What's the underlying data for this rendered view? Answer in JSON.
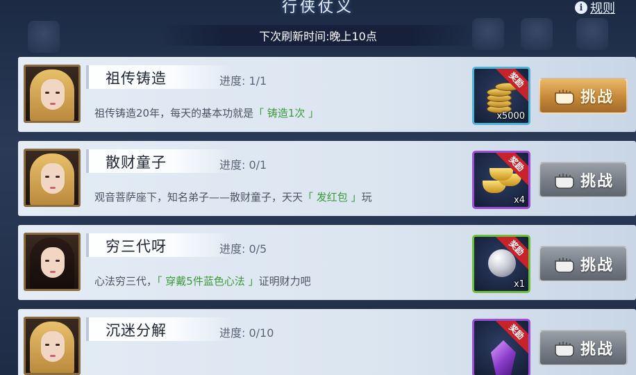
{
  "header": {
    "title": "行侠仗义",
    "rules_label": "规则",
    "refresh_text": "下次刷新时间:晚上10点"
  },
  "colors": {
    "highlight_green": "#3a9a3a",
    "ribbon_red": "#c8222a",
    "button_gold": "#c98c3c",
    "button_gray": "#7a8089"
  },
  "tasks": [
    {
      "name": "祖传铸造",
      "progress": "进度: 1/1",
      "desc_prefix": "祖传铸造20年，每天的基本功就是",
      "desc_highlight": "「 铸造1次 」",
      "desc_suffix": "",
      "reward_ribbon": "奖励",
      "reward_icon": "gold-coins-icon",
      "reward_qty": "x5000",
      "button_label": "挑战",
      "button_state": "active"
    },
    {
      "name": "散财童子",
      "progress": "进度: 0/1",
      "desc_prefix": "观音菩萨座下，知名弟子——散财童子，天天",
      "desc_highlight": "「 发红包 」",
      "desc_suffix": "玩",
      "reward_ribbon": "奖励",
      "reward_icon": "gold-ingot-icon",
      "reward_qty": "x4",
      "button_label": "挑战",
      "button_state": "inactive"
    },
    {
      "name": "穷三代呀",
      "progress": "进度: 0/5",
      "desc_prefix": "心法穷三代，",
      "desc_highlight": "「 穿戴5件蓝色心法 」",
      "desc_suffix": "证明财力吧",
      "reward_ribbon": "奖励",
      "reward_icon": "pearl-icon",
      "reward_qty": "x1",
      "button_label": "挑战",
      "button_state": "inactive"
    },
    {
      "name": "沉迷分解",
      "progress": "进度: 0/10",
      "desc_prefix": "",
      "desc_highlight": "",
      "desc_suffix": "",
      "reward_ribbon": "奖励",
      "reward_icon": "purple-crystal-icon",
      "reward_qty": "",
      "button_label": "挑战",
      "button_state": "inactive"
    }
  ]
}
